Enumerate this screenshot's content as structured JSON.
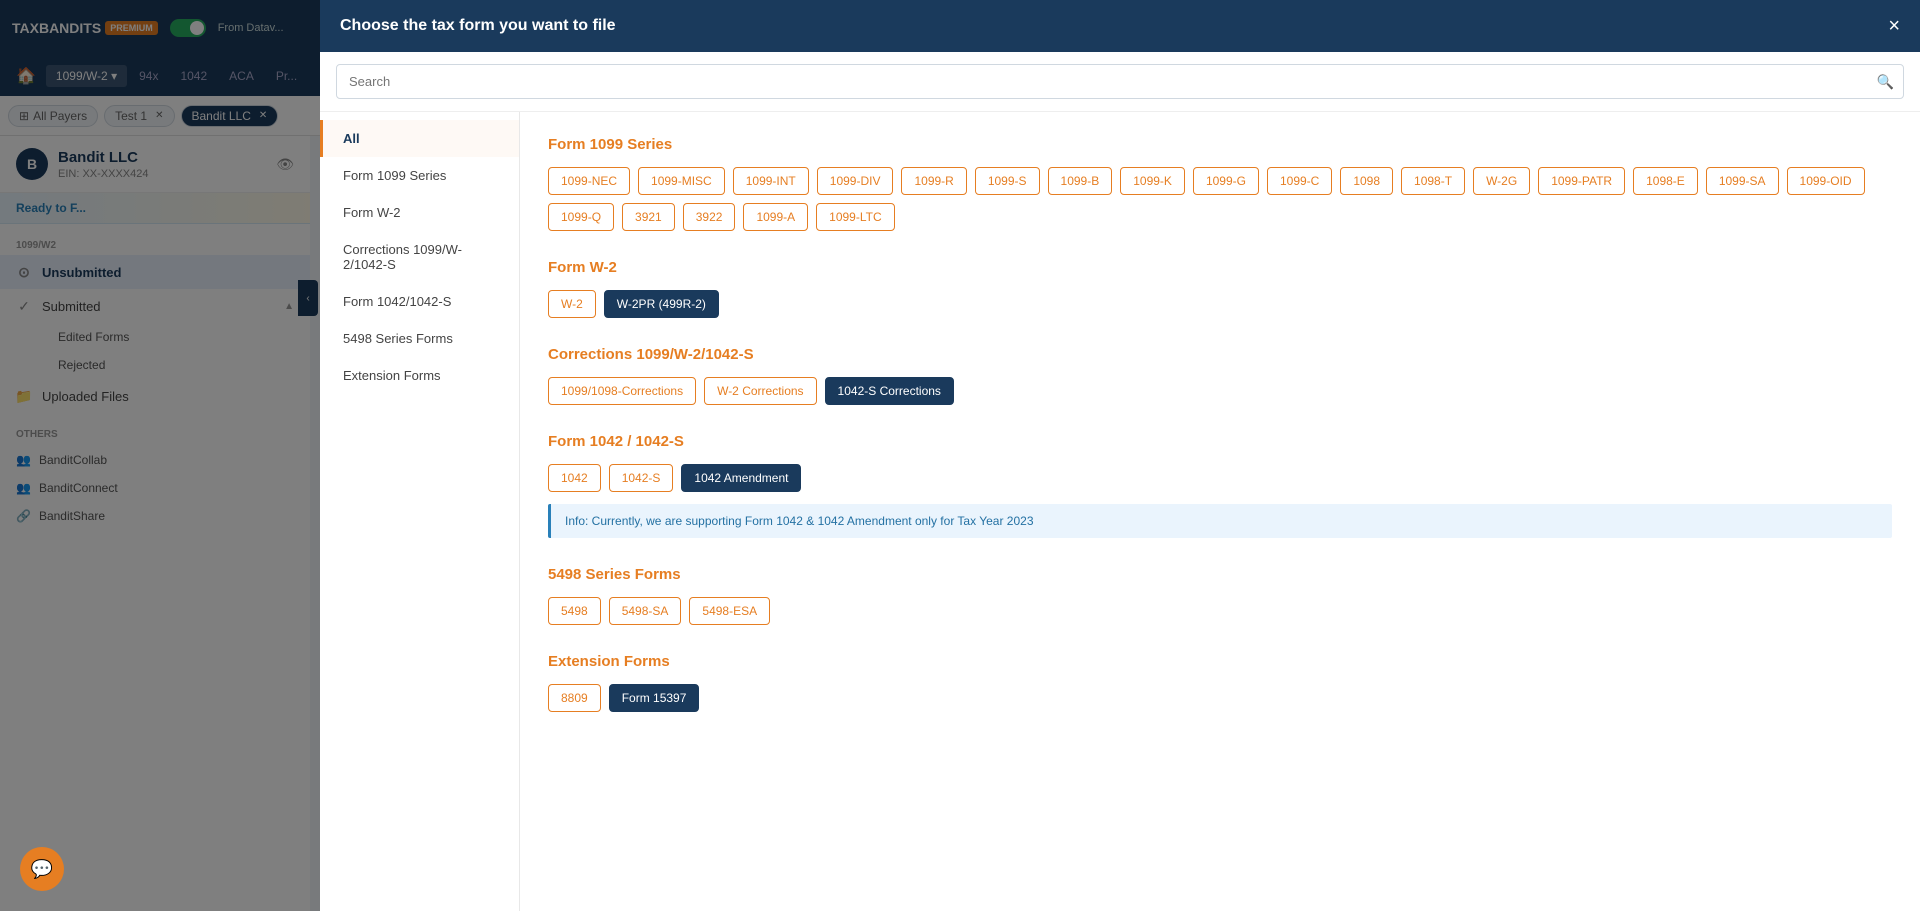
{
  "app": {
    "logo": "TAXBANDITS",
    "premium_badge": "PREMIUM",
    "from_data": "From Datav...",
    "nav_tabs": [
      {
        "label": "🏠",
        "type": "icon"
      },
      {
        "label": "1099/W-2",
        "active": true
      },
      {
        "label": "94x"
      },
      {
        "label": "1042"
      },
      {
        "label": "ACA"
      },
      {
        "label": "Pr..."
      }
    ]
  },
  "breadcrumbs": [
    {
      "label": "All Payers"
    },
    {
      "label": "Test 1",
      "closeable": true
    },
    {
      "label": "Bandit LLC",
      "closeable": true,
      "active": true
    }
  ],
  "payer": {
    "name": "Bandit LLC",
    "ein": "EIN: XX-XXXX424",
    "avatar": "B",
    "ready_label": "Ready to F..."
  },
  "sidebar": {
    "section_label": "1099/W2",
    "items": [
      {
        "label": "Unsubmitted",
        "icon": "⊙",
        "active": true
      },
      {
        "label": "Submitted",
        "icon": "✓",
        "expandable": true,
        "expanded": true
      },
      {
        "label": "Edited Forms",
        "sub": true
      },
      {
        "label": "Rejected",
        "sub": true
      },
      {
        "label": "Uploaded Files",
        "icon": "📁"
      }
    ],
    "others_label": "OTHERS",
    "others_items": [
      {
        "label": "BanditCollab",
        "icon": "👥"
      },
      {
        "label": "BanditConnect",
        "icon": "👥"
      },
      {
        "label": "BanditShare",
        "icon": "🔗"
      }
    ]
  },
  "modal": {
    "title": "Choose the tax form you want to file",
    "close_label": "×",
    "search_placeholder": "Search",
    "nav_items": [
      {
        "label": "All",
        "active": true
      },
      {
        "label": "Form 1099 Series"
      },
      {
        "label": "Form W-2"
      },
      {
        "label": "Corrections 1099/W-2/1042-S"
      },
      {
        "label": "Form 1042/1042-S"
      },
      {
        "label": "5498 Series Forms"
      },
      {
        "label": "Extension Forms"
      }
    ],
    "sections": [
      {
        "id": "form1099",
        "title": "Form 1099 Series",
        "tags": [
          "1099-NEC",
          "1099-MISC",
          "1099-INT",
          "1099-DIV",
          "1099-R",
          "1099-S",
          "1099-B",
          "1099-K",
          "1099-G",
          "1099-C",
          "1098",
          "1098-T",
          "W-2G",
          "1099-PATR",
          "1098-E",
          "1099-SA",
          "1099-OID",
          "1099-Q",
          "3921",
          "3922",
          "1099-A",
          "1099-LTC"
        ]
      },
      {
        "id": "formW2",
        "title": "Form W-2",
        "tags": [
          "W-2",
          "W-2PR (499R-2)"
        ],
        "selected_index": 1
      },
      {
        "id": "corrections",
        "title": "Corrections 1099/W-2/1042-S",
        "tags": [
          "1099/1098-Corrections",
          "W-2 Corrections",
          "1042-S Corrections"
        ],
        "selected_index": 2
      },
      {
        "id": "form1042",
        "title": "Form 1042 / 1042-S",
        "tags": [
          "1042",
          "1042-S",
          "1042 Amendment"
        ],
        "selected_index": 2,
        "info": "Info: Currently, we are supporting Form 1042 & 1042 Amendment only for Tax Year 2023"
      },
      {
        "id": "5498",
        "title": "5498 Series Forms",
        "tags": [
          "5498",
          "5498-SA",
          "5498-ESA"
        ]
      },
      {
        "id": "extension",
        "title": "Extension Forms",
        "tags": [
          "8809",
          "Form 15397"
        ],
        "selected_index": 1
      }
    ]
  }
}
